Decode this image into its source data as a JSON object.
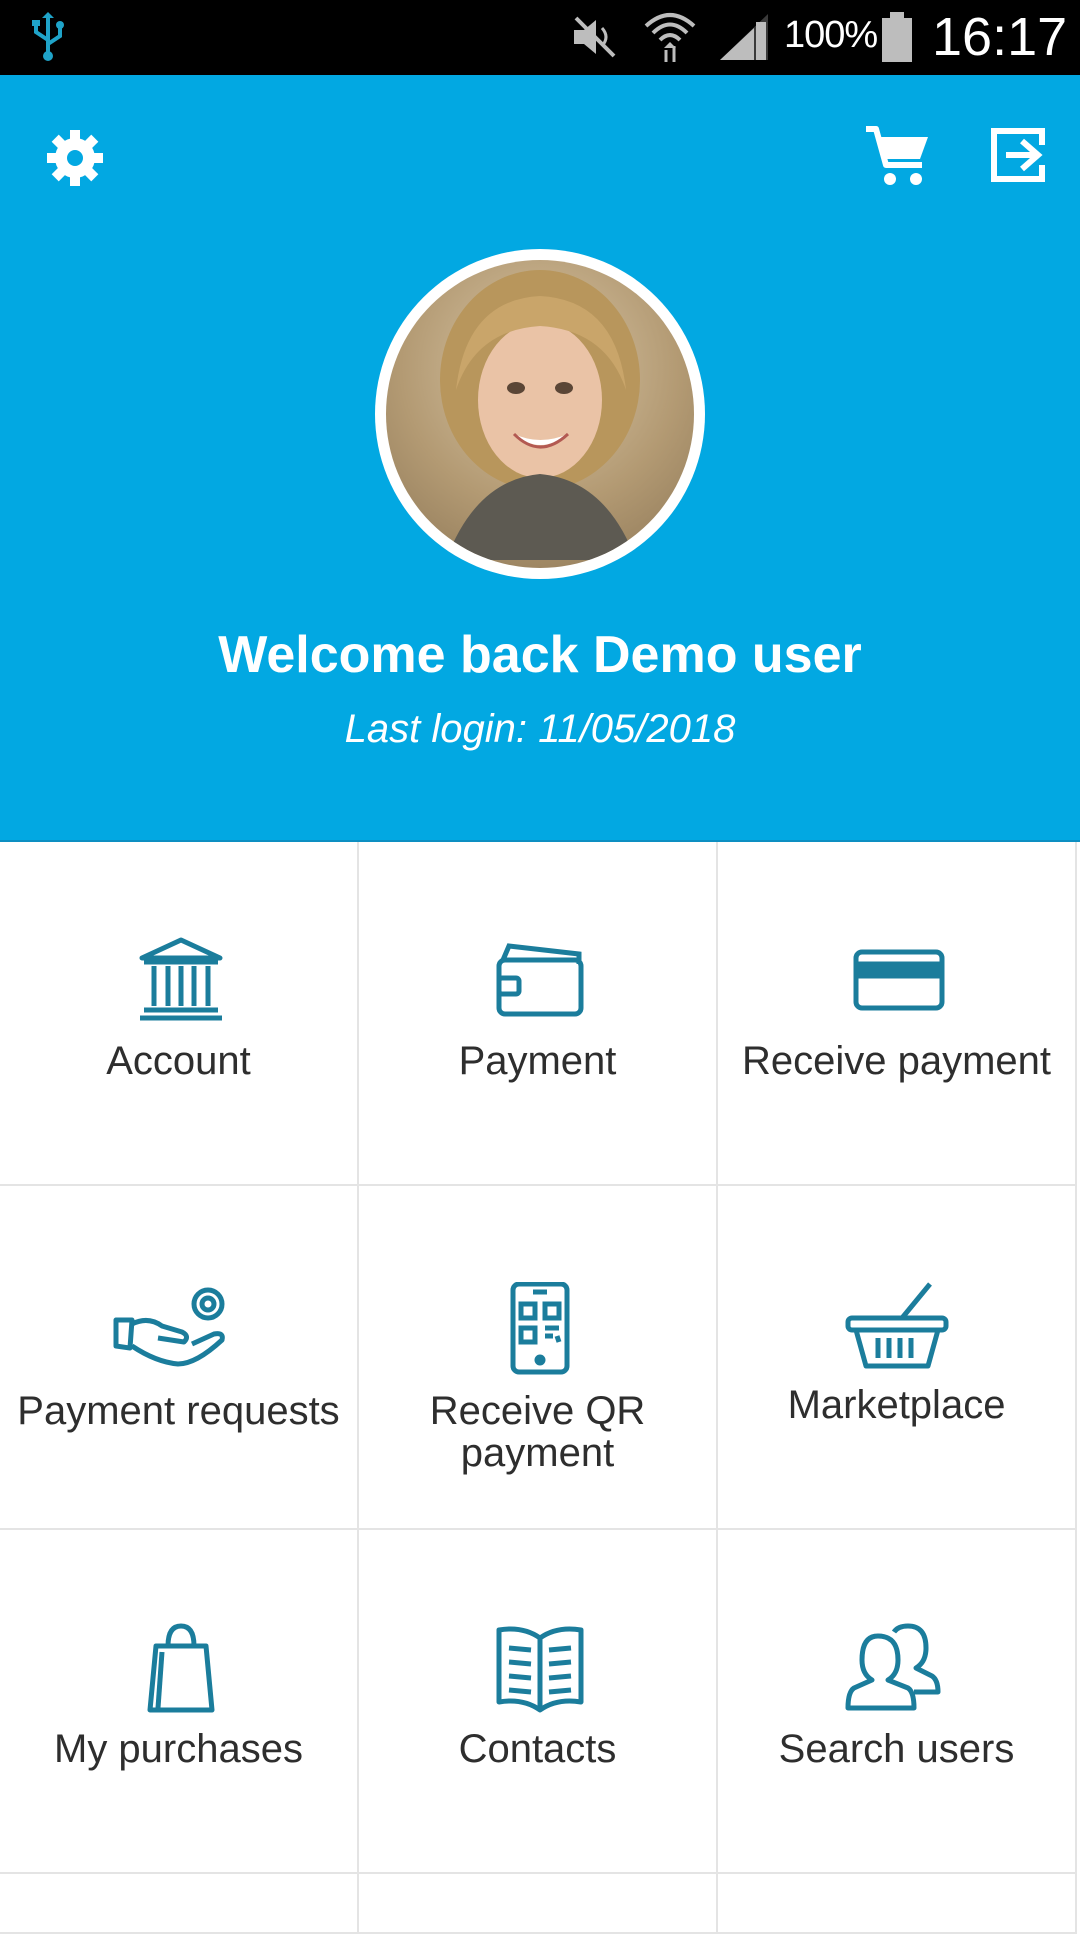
{
  "status_bar": {
    "battery_percent": "100%",
    "time": "16:17",
    "icons": [
      "usb-icon",
      "mute-icon",
      "wifi-icon",
      "signal-icon",
      "battery-icon"
    ]
  },
  "header": {
    "background_color": "#02a8e2",
    "welcome_text": "Welcome back Demo user",
    "last_login": "Last login: 11/05/2018",
    "icons": [
      "settings-icon",
      "cart-icon",
      "logout-icon"
    ]
  },
  "grid": {
    "icon_color": "#1b7d9c",
    "items": [
      {
        "label": "Account",
        "icon": "bank-icon"
      },
      {
        "label": "Payment",
        "icon": "wallet-icon"
      },
      {
        "label": "Receive payment",
        "icon": "credit-card-icon"
      },
      {
        "label": "Payment requests",
        "icon": "hand-coin-icon"
      },
      {
        "label": "Receive QR payment",
        "icon": "qr-phone-icon"
      },
      {
        "label": "Marketplace",
        "icon": "basket-icon"
      },
      {
        "label": "My purchases",
        "icon": "shopping-bag-icon"
      },
      {
        "label": "Contacts",
        "icon": "book-icon"
      },
      {
        "label": "Search users",
        "icon": "users-icon"
      }
    ]
  }
}
